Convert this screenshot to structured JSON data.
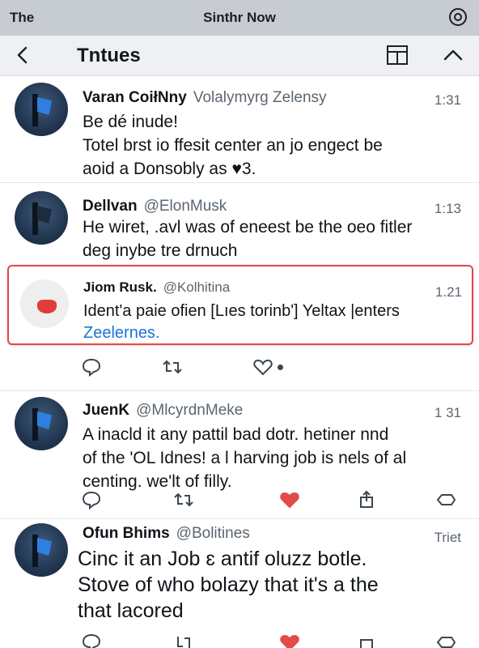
{
  "status_bar": {
    "left": "The",
    "center": "Sinthr Now"
  },
  "top_bar": {
    "title": "Tntues"
  },
  "tweets": [
    {
      "name": "Varan CoiłNny",
      "handle": "Volalymyrg Zelensy",
      "time": "1:31",
      "lines": [
        "Be dé inude!",
        "Totel brst io ffesit center an jo engect be",
        "aoid a Donsobly as ♥3."
      ]
    },
    {
      "name": "Dellvan",
      "handle": "@ElonMusk",
      "time": "1:13",
      "lines": [
        "He wiret, .avl was of eneest be the oeo fitler",
        "deg inybe tre drnuch"
      ]
    },
    {
      "name": "Jiom Rusk.",
      "handle": "@Kolhitina",
      "time": "1.21",
      "lines": [
        "Ident'a paie ofien [Lıes torinb'] Yeltax |enters"
      ],
      "link": "Zeelernes."
    },
    {
      "name": "JuenK",
      "handle": "@MlcyrdnMeke",
      "time": "1 31",
      "lines": [
        "A inacld it any pattil bad dotr. hetiner nnd",
        "of the 'OL Idnes! a l harving job is nels of al",
        "centing. we'lt of filly."
      ]
    },
    {
      "name": "Ofun Bhims",
      "handle": "@Bolitines",
      "time": "Triet",
      "lines": [
        "Cinc it an Job ɛ antif oluzz botle.",
        "Stove of who bolazy that it's a the",
        "that lacored"
      ]
    }
  ],
  "icons": {
    "reply": "reply-icon",
    "retweet": "retweet-icon",
    "like": "heart-icon",
    "share": "share-icon"
  },
  "colors": {
    "accent": "#1a73d9",
    "highlight_border": "#e04848",
    "topbar": "#eef0f3"
  }
}
